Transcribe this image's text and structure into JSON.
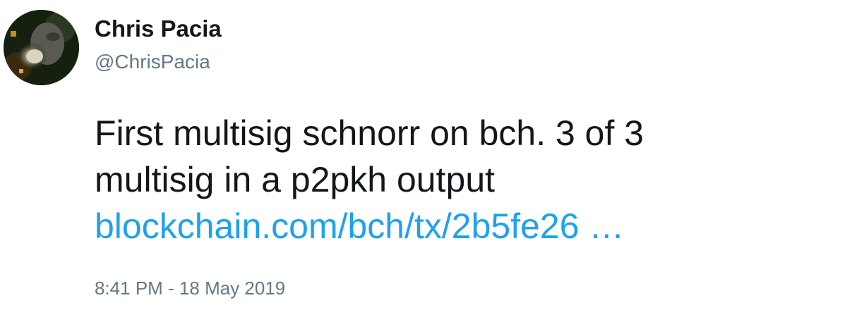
{
  "tweet": {
    "author": {
      "name": "Chris Pacia",
      "handle": "@ChrisPacia"
    },
    "text_line_1": "First multisig schnorr on bch. 3 of 3",
    "text_line_2": "multisig in a p2pkh output",
    "link": "blockchain.com/bch/tx/2b5fe26 …",
    "timestamp": "8:41 PM - 18 May 2019"
  },
  "colors": {
    "text": "#14171a",
    "secondary": "#657786",
    "link": "#1da1f2",
    "background": "#ffffff"
  }
}
